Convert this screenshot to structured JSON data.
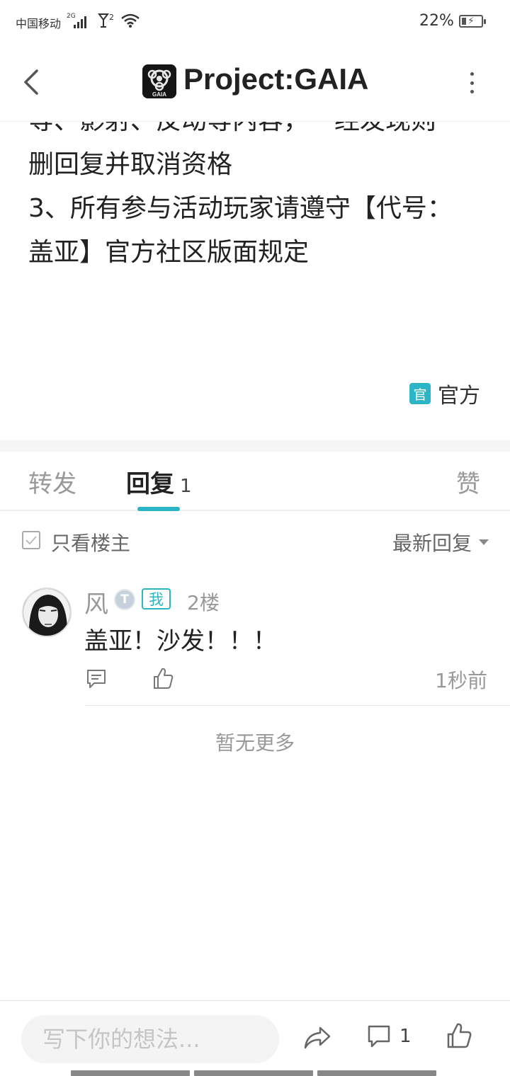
{
  "status_bar": {
    "carrier": "中国移动",
    "network_tag": "2G",
    "sim2_tag": "2",
    "battery_percent": "22%",
    "battery_level": 0.22
  },
  "header": {
    "title": "Project:GAIA",
    "logo_text": "GAIA"
  },
  "post": {
    "lines": [
      "等、影射、反动等内容，一经发现则",
      "删回复并取消资格",
      "3、所有参与活动玩家请遵守【代号：",
      "盖亚】官方社区版面规定"
    ],
    "official_badge": "官",
    "official_label": "官方"
  },
  "tabs": {
    "forward": "转发",
    "reply": "回复",
    "reply_count": "1",
    "like": "赞"
  },
  "filter": {
    "only_owner": "只看楼主",
    "sort": "最新回复"
  },
  "comment": {
    "name": "风",
    "level_icon": "T",
    "me_badge": "我",
    "floor": "2楼",
    "text": "盖亚！沙发！！！",
    "time": "1秒前"
  },
  "no_more": "暂无更多",
  "bottom_bar": {
    "input_placeholder": "写下你的想法...",
    "comment_count": "1"
  },
  "colors": {
    "accent": "#2bb5c6"
  },
  "icons": {
    "back": "chevron-left-icon",
    "more": "more-vertical-icon",
    "reply": "comment-icon",
    "like": "thumbs-up-icon",
    "share": "share-icon"
  }
}
